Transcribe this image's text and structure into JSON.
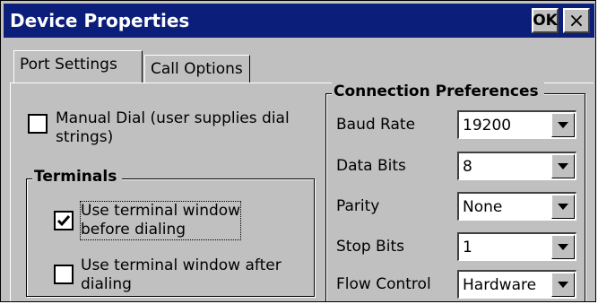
{
  "window": {
    "title": "Device Properties",
    "ok_label": "OK",
    "close_label": "×"
  },
  "tabs": [
    {
      "label": "Port Settings",
      "active": true
    },
    {
      "label": "Call Options",
      "active": false
    }
  ],
  "manual_dial": {
    "line1": "Manual Dial (user supplies dial",
    "line2": "strings)",
    "checked": false
  },
  "terminals": {
    "title": "Terminals",
    "before": {
      "line1": "Use terminal window",
      "line2": "before dialing",
      "checked": true
    },
    "after": {
      "line1": "Use terminal window after",
      "line2": "dialing",
      "checked": false
    }
  },
  "connection": {
    "title": "Connection Preferences",
    "fields": [
      {
        "label": "Baud Rate",
        "value": "19200"
      },
      {
        "label": "Data Bits",
        "value": "8"
      },
      {
        "label": "Parity",
        "value": "None"
      },
      {
        "label": "Stop Bits",
        "value": "1"
      },
      {
        "label": "Flow Control",
        "value": "Hardware"
      }
    ]
  },
  "colors": {
    "titlebar": "#0a1e7a",
    "face": "#c0c0c0"
  }
}
